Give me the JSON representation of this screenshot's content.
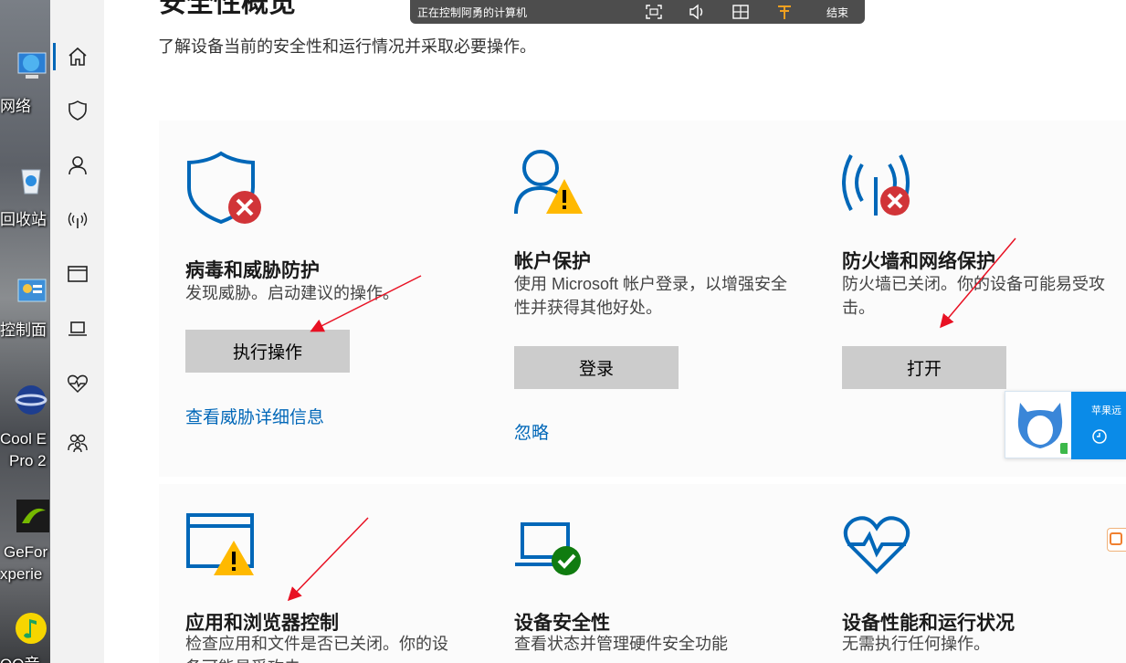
{
  "desktop": {
    "labels": [
      "网络",
      "回收站",
      "控制面",
      "Cool E",
      "Pro 2",
      "GeFor",
      "xperie",
      "QQ音"
    ]
  },
  "sidebar": {
    "items": [
      {
        "name": "home",
        "active": true
      },
      {
        "name": "virus-protection"
      },
      {
        "name": "account-protection"
      },
      {
        "name": "firewall-network"
      },
      {
        "name": "app-browser-control"
      },
      {
        "name": "device-security"
      },
      {
        "name": "device-performance"
      },
      {
        "name": "family-options"
      }
    ]
  },
  "page": {
    "title": "安全性概览",
    "subtitle": "了解设备当前的安全性和运行情况并采取必要操作。"
  },
  "tiles": {
    "virus": {
      "title": "病毒和威胁防护",
      "desc": "发现威胁。启动建议的操作。",
      "button": "执行操作",
      "link": "查看威胁详细信息",
      "status": "error"
    },
    "account": {
      "title": "帐户保护",
      "desc": "使用 Microsoft 帐户登录，以增强安全性并获得其他好处。",
      "button": "登录",
      "link": "忽略",
      "status": "warning"
    },
    "firewall": {
      "title": "防火墙和网络保护",
      "desc": "防火墙已关闭。你的设备可能易受攻击。",
      "button": "打开",
      "status": "error"
    },
    "app": {
      "title": "应用和浏览器控制",
      "desc": "检查应用和文件是否已关闭。你的设备可能易受攻击。",
      "status": "warning"
    },
    "device": {
      "title": "设备安全性",
      "desc": "查看状态并管理硬件安全功能",
      "status": "ok"
    },
    "performance": {
      "title": "设备性能和运行状况",
      "desc": "无需执行任何操作。",
      "status": "ok"
    }
  },
  "remote_bar": {
    "text": "正在控制阿勇的计算机",
    "end_label": "结束"
  },
  "widget": {
    "text": "苹果远"
  },
  "colors": {
    "accent": "#0067b8",
    "error": "#d13438",
    "warning": "#ffb900",
    "ok": "#107c10",
    "annotation": "#e81123"
  }
}
